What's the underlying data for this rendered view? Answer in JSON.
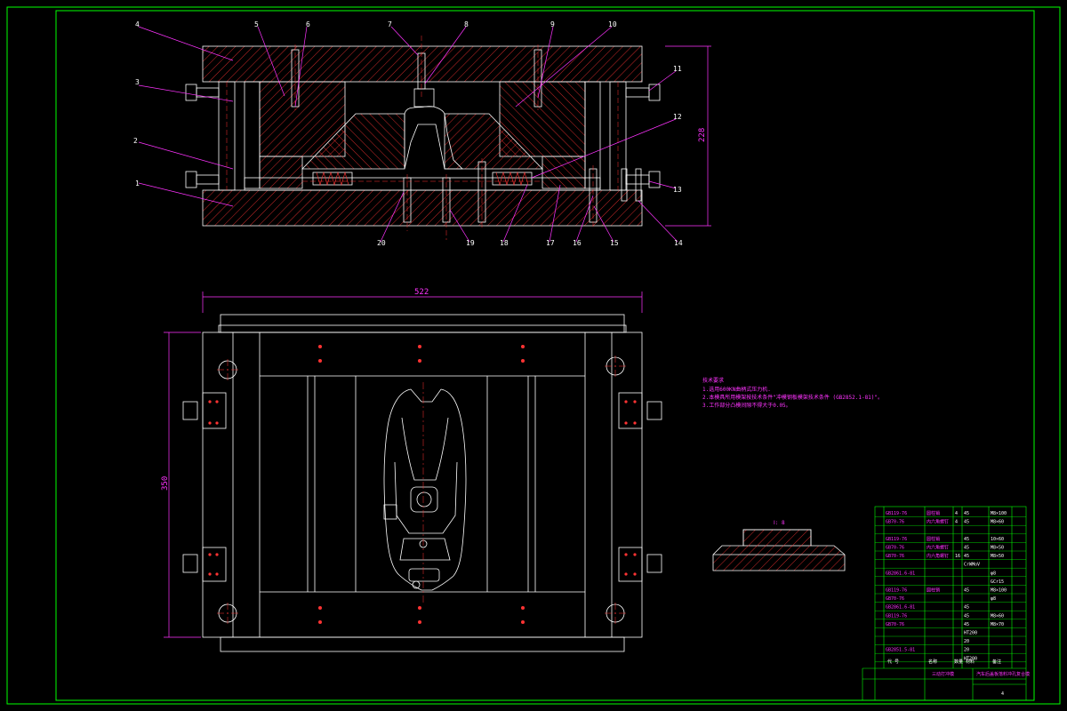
{
  "drawing": {
    "colors": {
      "background": "#000000",
      "frame": "#00ff00",
      "outline": "#ffffff",
      "hatch": "#ff3333",
      "leader": "#ff33ff",
      "centerline": "#ff3333",
      "dimension": "#ff33ff"
    },
    "part_labels_top": [
      "4",
      "3",
      "6",
      "7",
      "8",
      "9",
      "10"
    ],
    "part_labels_left": [
      "3",
      "2",
      "1"
    ],
    "part_labels_right": [
      "11",
      "12",
      "13",
      "14"
    ],
    "part_labels_bottom": [
      "20",
      "19",
      "18",
      "17",
      "16",
      "15"
    ],
    "dim_height_section": "228",
    "dim_width_plan": "522",
    "dim_height_plan": "350",
    "detail_label": "Ⅰ: 8",
    "tech_notes": {
      "heading": "技术要求",
      "lines": [
        "1.选用600KN曲柄式压力机.",
        "2.本模具所用模架按技术条件\"冲模钢板模架技术条件 (GB2852.1-81)\"。",
        "3.工作部分凸模间隙不得大于0.05。"
      ]
    },
    "bom_rows": [
      {
        "std": "GB119-76",
        "name": "圆柱销",
        "qty": "4",
        "mat": "45",
        "spec": "M8×100"
      },
      {
        "std": "GB70-76",
        "name": "内六角螺钉",
        "qty": "4",
        "mat": "45",
        "spec": "M8×60"
      },
      {
        "std": "",
        "name": "",
        "qty": "",
        "mat": "",
        "spec": ""
      },
      {
        "std": "GB119-76",
        "name": "圆柱销",
        "qty": "",
        "mat": "45",
        "spec": "10×60"
      },
      {
        "std": "GB70-76",
        "name": "内六角螺钉",
        "qty": "",
        "mat": "45",
        "spec": "M8×50"
      },
      {
        "std": "GB70-76",
        "name": "内六角螺钉",
        "qty": "16",
        "mat": "45",
        "spec": "M8×50"
      },
      {
        "std": "",
        "name": "",
        "qty": "",
        "mat": "CrWMoV",
        "spec": ""
      },
      {
        "std": "GB2861.6-81",
        "name": "",
        "qty": "",
        "mat": "",
        "spec": "φ8"
      },
      {
        "std": "",
        "name": "",
        "qty": "",
        "mat": "",
        "spec": "GCr15"
      },
      {
        "std": "GB119-76",
        "name": "圆柱销",
        "qty": "",
        "mat": "45",
        "spec": "M8×100"
      },
      {
        "std": "GB70-76",
        "name": "",
        "qty": "",
        "mat": "",
        "spec": "φ8"
      },
      {
        "std": "GB2861.6-81",
        "name": "",
        "qty": "",
        "mat": "45",
        "spec": ""
      },
      {
        "std": "GB119-76",
        "name": "",
        "qty": "",
        "mat": "45",
        "spec": "M8×60"
      },
      {
        "std": "GB70-76",
        "name": "",
        "qty": "",
        "mat": "45",
        "spec": "M8×70"
      },
      {
        "std": "",
        "name": "",
        "qty": "",
        "mat": "HT200",
        "spec": ""
      },
      {
        "std": "",
        "name": "",
        "qty": "",
        "mat": "20",
        "spec": ""
      },
      {
        "std": "GB2851.5-81",
        "name": "",
        "qty": "",
        "mat": "20",
        "spec": ""
      },
      {
        "std": "",
        "name": "",
        "qty": "",
        "mat": "HT200",
        "spec": ""
      }
    ],
    "title_block": {
      "header_no": "代 号",
      "header_name": "名称",
      "header_qty": "数量",
      "header_mat": "材料",
      "header_note": "备注",
      "drawing_name": "三动打冲模",
      "part_name": "汽车后盖板落料冲孔复合模",
      "sheet": "4"
    }
  }
}
